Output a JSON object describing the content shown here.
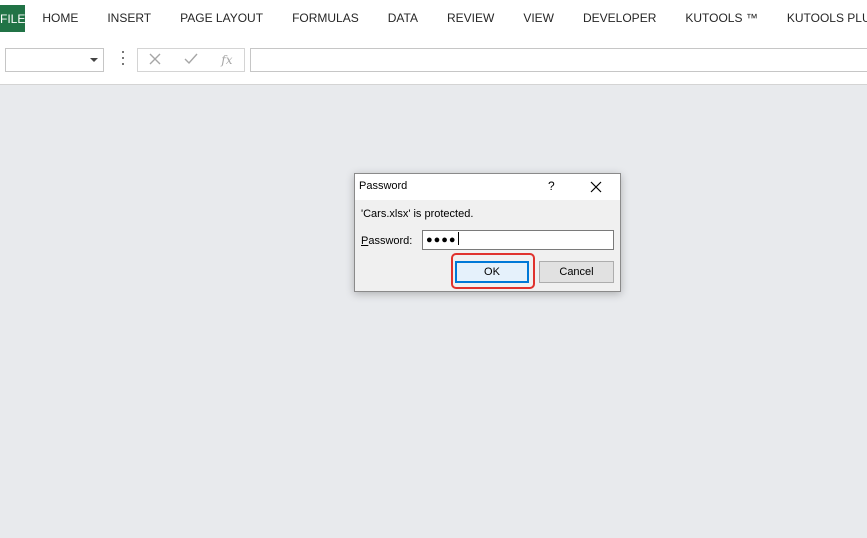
{
  "ribbon": {
    "tabs": [
      "FILE",
      "HOME",
      "INSERT",
      "PAGE LAYOUT",
      "FORMULAS",
      "DATA",
      "REVIEW",
      "VIEW",
      "DEVELOPER",
      "KUTOOLS ™",
      "KUTOOLS PLUS"
    ],
    "file_color": "#217346"
  },
  "formula_bar": {
    "name_box_value": "",
    "cancel_icon": "x-icon",
    "enter_icon": "check-icon",
    "function_label": "fx",
    "formula_value": ""
  },
  "dialog": {
    "title": "Password",
    "help_label": "?",
    "message": "'Cars.xlsx' is protected.",
    "password_label_underlined": "P",
    "password_label_rest": "assword:",
    "password_value": "●●●●",
    "ok_label": "OK",
    "cancel_label": "Cancel",
    "highlight_color": "#e0322d",
    "focus_color": "#0078d7"
  }
}
